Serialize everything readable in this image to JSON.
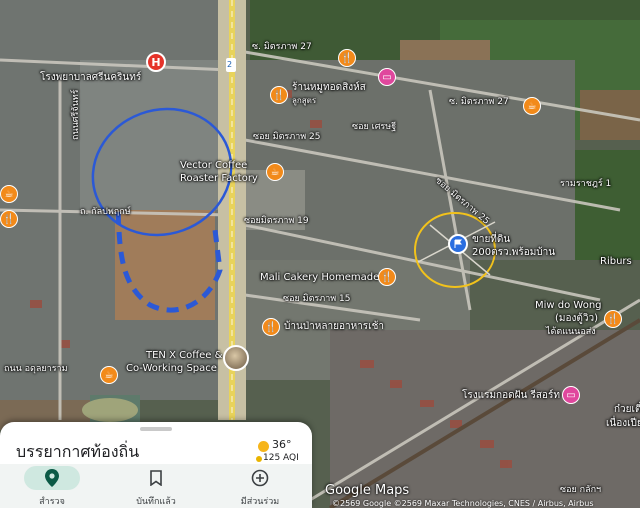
{
  "colors": {
    "poi_food": "#f28a1a",
    "poi_lodging": "#e0479d",
    "hospital": "#e5332a",
    "selected": "#2b6fd6",
    "highlight_circle": "#f2c21b"
  },
  "map_labels": {
    "hospital": "โรงพยาบาลศรีนครินทร์",
    "road_mitraphap27_a": "ซ. มิตรภาพ 27",
    "road_mitraphap27_b": "ซ. มิตรภาพ 27",
    "restaurant1_line1": "ร้านหมูทอดสิงห์ส",
    "restaurant1_line2": "ลูกสูตร",
    "road_mitraphap25": "ซอย มิตรภาพ 25",
    "road_mitraphap25_b": "ซอย มิตรภาพ 25",
    "road_setthi": "ซอย เศรษฐี",
    "vector_line1": "Vector Coffee",
    "vector_line2": "Roaster Factory",
    "road_kangjaroen": "ถ. กัลปพฤกษ์",
    "road_mitraphap19": "ซอยมิตรภาพ 19",
    "land_line1": "ขายที่ดิน",
    "land_line2": "200ตรว.พร้อมบ้าน",
    "mali": "Mali Cakery Homemade",
    "road_mitraphap15": "ซอย มิตรภาพ 15",
    "breakfast": "บ้านป่าหลายอาหารเช้า",
    "tenx_line1": "TEN X Coffee &",
    "tenx_line2": "Co-Working Space",
    "miw_line1": "Miw do Wong",
    "miw_line2": "(มองตู้วิว)",
    "miw_line3": "ได้ตแนนอส่ง",
    "hotel": "โรงแรมกอดฝัน รีสอร์ท",
    "riburs": "Riburs",
    "road_ab": "ถนน อดุลยาราม",
    "road_side_left": "ถนนศรีจันทร์",
    "right_edge": "เนื่องเปีย",
    "right_edge2": "ก๋วยเตี๋ย",
    "road_bottom": "ซอย กลักฯ",
    "road_rr": "รามราชฎร์ 1",
    "sign_2": "2"
  },
  "sheet": {
    "title": "บรรยากาศท้องถิ่น",
    "temperature": "36°",
    "aqi": "125 AQI"
  },
  "nav": [
    {
      "label": "สำรวจ",
      "icon": "location-pin-icon",
      "active": true
    },
    {
      "label": "บันทึกแล้ว",
      "icon": "bookmark-icon",
      "active": false
    },
    {
      "label": "มีส่วนร่วม",
      "icon": "add-circle-icon",
      "active": false
    }
  ],
  "brand": "Google Maps",
  "copyright": "©2569 Google ©2569 Maxar Technologies, CNES / Airbus, Airbus"
}
